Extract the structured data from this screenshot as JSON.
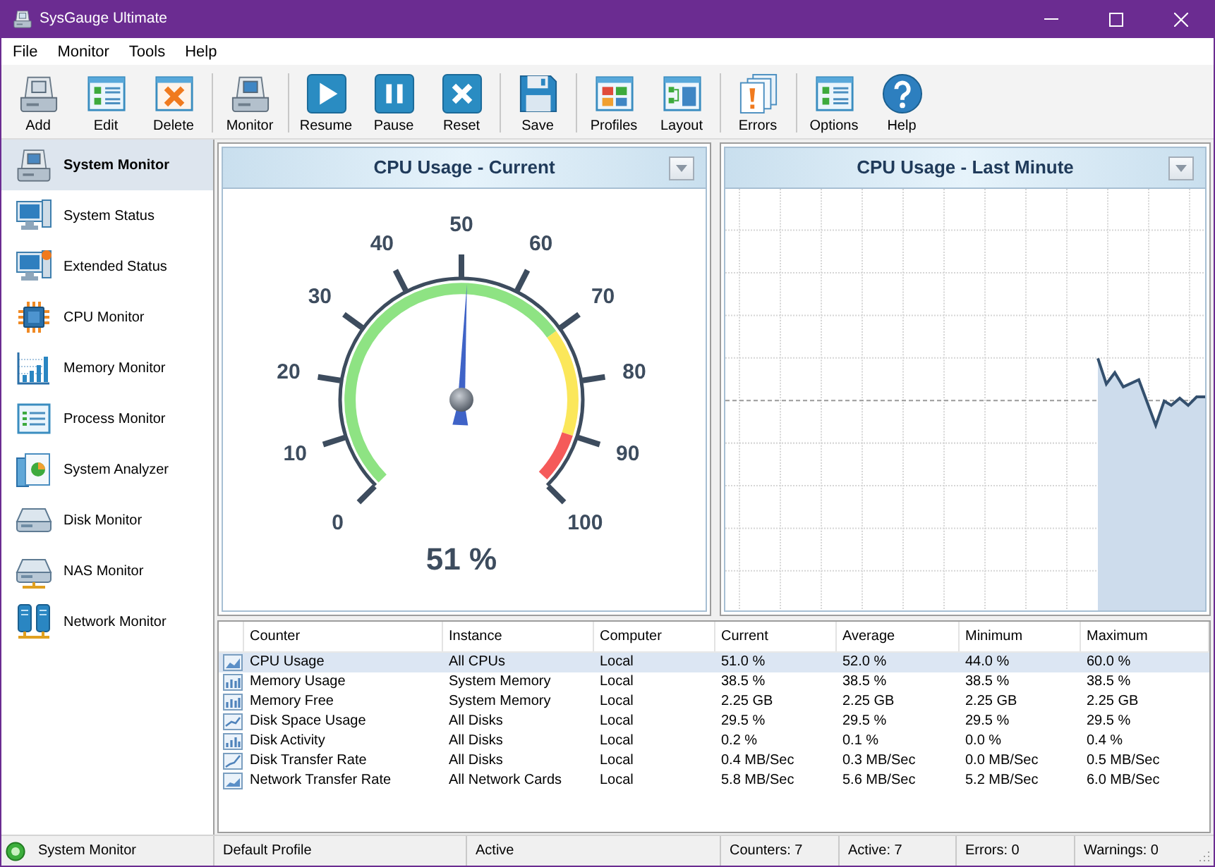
{
  "window": {
    "title": "SysGauge Ultimate"
  },
  "menu": [
    "File",
    "Monitor",
    "Tools",
    "Help"
  ],
  "toolbar": {
    "groups": [
      [
        {
          "label": "Add"
        },
        {
          "label": "Edit"
        },
        {
          "label": "Delete"
        }
      ],
      [
        {
          "label": "Monitor"
        }
      ],
      [
        {
          "label": "Resume"
        },
        {
          "label": "Pause"
        },
        {
          "label": "Reset"
        }
      ],
      [
        {
          "label": "Save"
        }
      ],
      [
        {
          "label": "Profiles"
        },
        {
          "label": "Layout"
        }
      ],
      [
        {
          "label": "Errors"
        }
      ],
      [
        {
          "label": "Options"
        },
        {
          "label": "Help"
        }
      ]
    ]
  },
  "sidebar": {
    "items": [
      {
        "label": "System Monitor",
        "selected": true
      },
      {
        "label": "System Status",
        "selected": false
      },
      {
        "label": "Extended Status",
        "selected": false
      },
      {
        "label": "CPU Monitor",
        "selected": false
      },
      {
        "label": "Memory Monitor",
        "selected": false
      },
      {
        "label": "Process Monitor",
        "selected": false
      },
      {
        "label": "System Analyzer",
        "selected": false
      },
      {
        "label": "Disk Monitor",
        "selected": false
      },
      {
        "label": "NAS Monitor",
        "selected": false
      },
      {
        "label": "Network Monitor",
        "selected": false
      }
    ]
  },
  "gauge_panel": {
    "title": "CPU Usage - Current",
    "scale_labels": [
      "0",
      "10",
      "20",
      "30",
      "40",
      "50",
      "60",
      "70",
      "80",
      "90",
      "100"
    ],
    "level": 0.51,
    "reading": "51 %"
  },
  "history_panel": {
    "title": "CPU Usage - Last Minute"
  },
  "table": {
    "columns": [
      "Counter",
      "Instance",
      "Computer",
      "Current",
      "Average",
      "Minimum",
      "Maximum"
    ],
    "rows": [
      {
        "selected": true,
        "cells": [
          "CPU Usage",
          "All CPUs",
          "Local",
          "51.0 %",
          "52.0 %",
          "44.0 %",
          "60.0 %"
        ]
      },
      {
        "selected": false,
        "cells": [
          "Memory Usage",
          "System Memory",
          "Local",
          "38.5 %",
          "38.5 %",
          "38.5 %",
          "38.5 %"
        ]
      },
      {
        "selected": false,
        "cells": [
          "Memory Free",
          "System Memory",
          "Local",
          "2.25 GB",
          "2.25 GB",
          "2.25 GB",
          "2.25 GB"
        ]
      },
      {
        "selected": false,
        "cells": [
          "Disk Space Usage",
          "All Disks",
          "Local",
          "29.5 %",
          "29.5 %",
          "29.5 %",
          "29.5 %"
        ]
      },
      {
        "selected": false,
        "cells": [
          "Disk Activity",
          "All Disks",
          "Local",
          "0.2 %",
          "0.1 %",
          "0.0 %",
          "0.4 %"
        ]
      },
      {
        "selected": false,
        "cells": [
          "Disk Transfer Rate",
          "All Disks",
          "Local",
          "0.4 MB/Sec",
          "0.3 MB/Sec",
          "0.0 MB/Sec",
          "0.5 MB/Sec"
        ]
      },
      {
        "selected": false,
        "cells": [
          "Network Transfer Rate",
          "All Network Cards",
          "Local",
          "5.8 MB/Sec",
          "5.6 MB/Sec",
          "5.2 MB/Sec",
          "6.0 MB/Sec"
        ]
      }
    ]
  },
  "status_bar": {
    "monitor": "System Monitor",
    "fields": [
      "Default Profile",
      "Active",
      "Counters: 7",
      "Active: 7",
      "Errors: 0",
      "Warnings: 0"
    ]
  }
}
